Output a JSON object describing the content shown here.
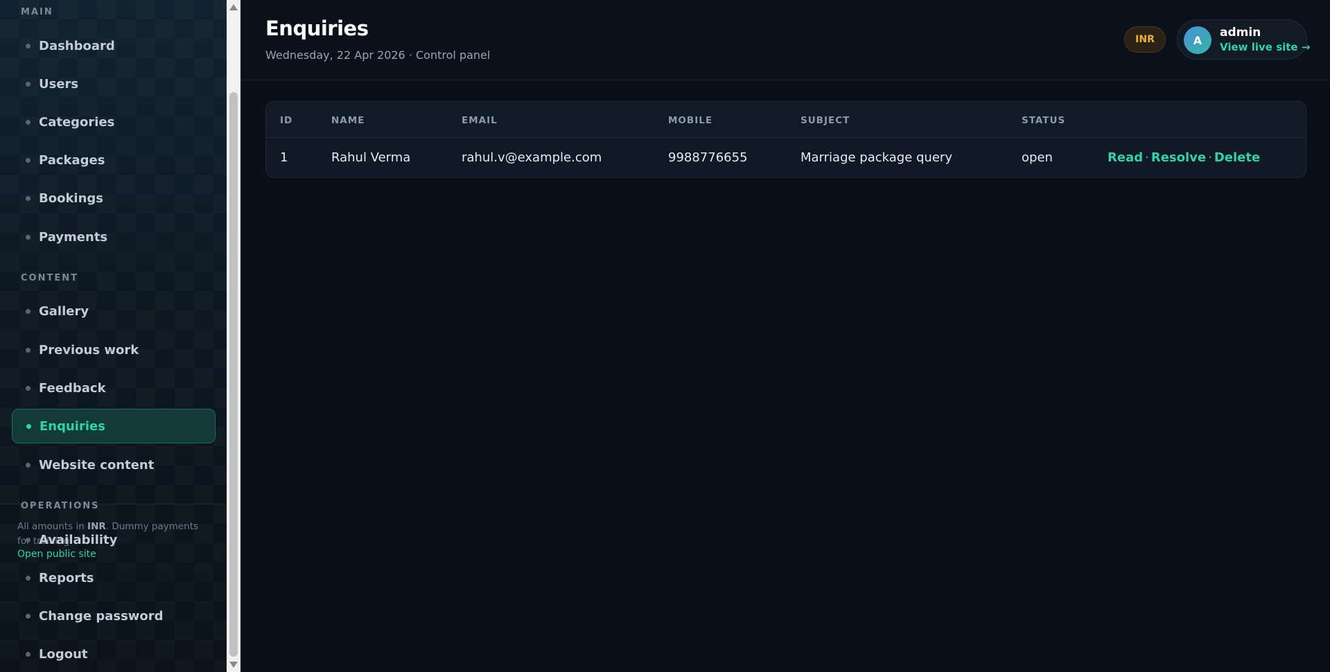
{
  "sidebar": {
    "sections": [
      {
        "label": "MAIN"
      },
      {
        "label": "CONTENT"
      },
      {
        "label": "OPERATIONS"
      }
    ],
    "items": [
      {
        "label": "Dashboard"
      },
      {
        "label": "Users"
      },
      {
        "label": "Categories"
      },
      {
        "label": "Packages"
      },
      {
        "label": "Bookings"
      },
      {
        "label": "Payments"
      },
      {
        "label": "Gallery"
      },
      {
        "label": "Previous work"
      },
      {
        "label": "Feedback"
      },
      {
        "label": "Enquiries",
        "active": true
      },
      {
        "label": "Website content"
      },
      {
        "label": "Availability"
      },
      {
        "label": "Reports"
      },
      {
        "label": "Change password"
      },
      {
        "label": "Logout"
      }
    ],
    "footnote_prefix": "All amounts in ",
    "footnote_currency": "INR",
    "footnote_suffix": ". Dummy payments for training.",
    "footnote_link": "Open public site"
  },
  "header": {
    "title": "Enquiries",
    "subtitle": "Wednesday, 22 Apr 2026 · Control panel",
    "currency_badge": "INR",
    "user": {
      "avatar_initial": "A",
      "name": "admin",
      "link": "View live site →"
    }
  },
  "table": {
    "columns": [
      "ID",
      "NAME",
      "EMAIL",
      "MOBILE",
      "SUBJECT",
      "STATUS"
    ],
    "rows": [
      {
        "id": "1",
        "name": "Rahul Verma",
        "email": "rahul.v@example.com",
        "mobile": "9988776655",
        "subject": "Marriage package query",
        "status": "open",
        "actions": [
          "Read",
          "Resolve",
          "Delete"
        ],
        "action_separator": "·"
      }
    ]
  },
  "colors": {
    "accent": "#2fd4a6",
    "badge": "#e7b43a",
    "background": "#0a0f18"
  }
}
